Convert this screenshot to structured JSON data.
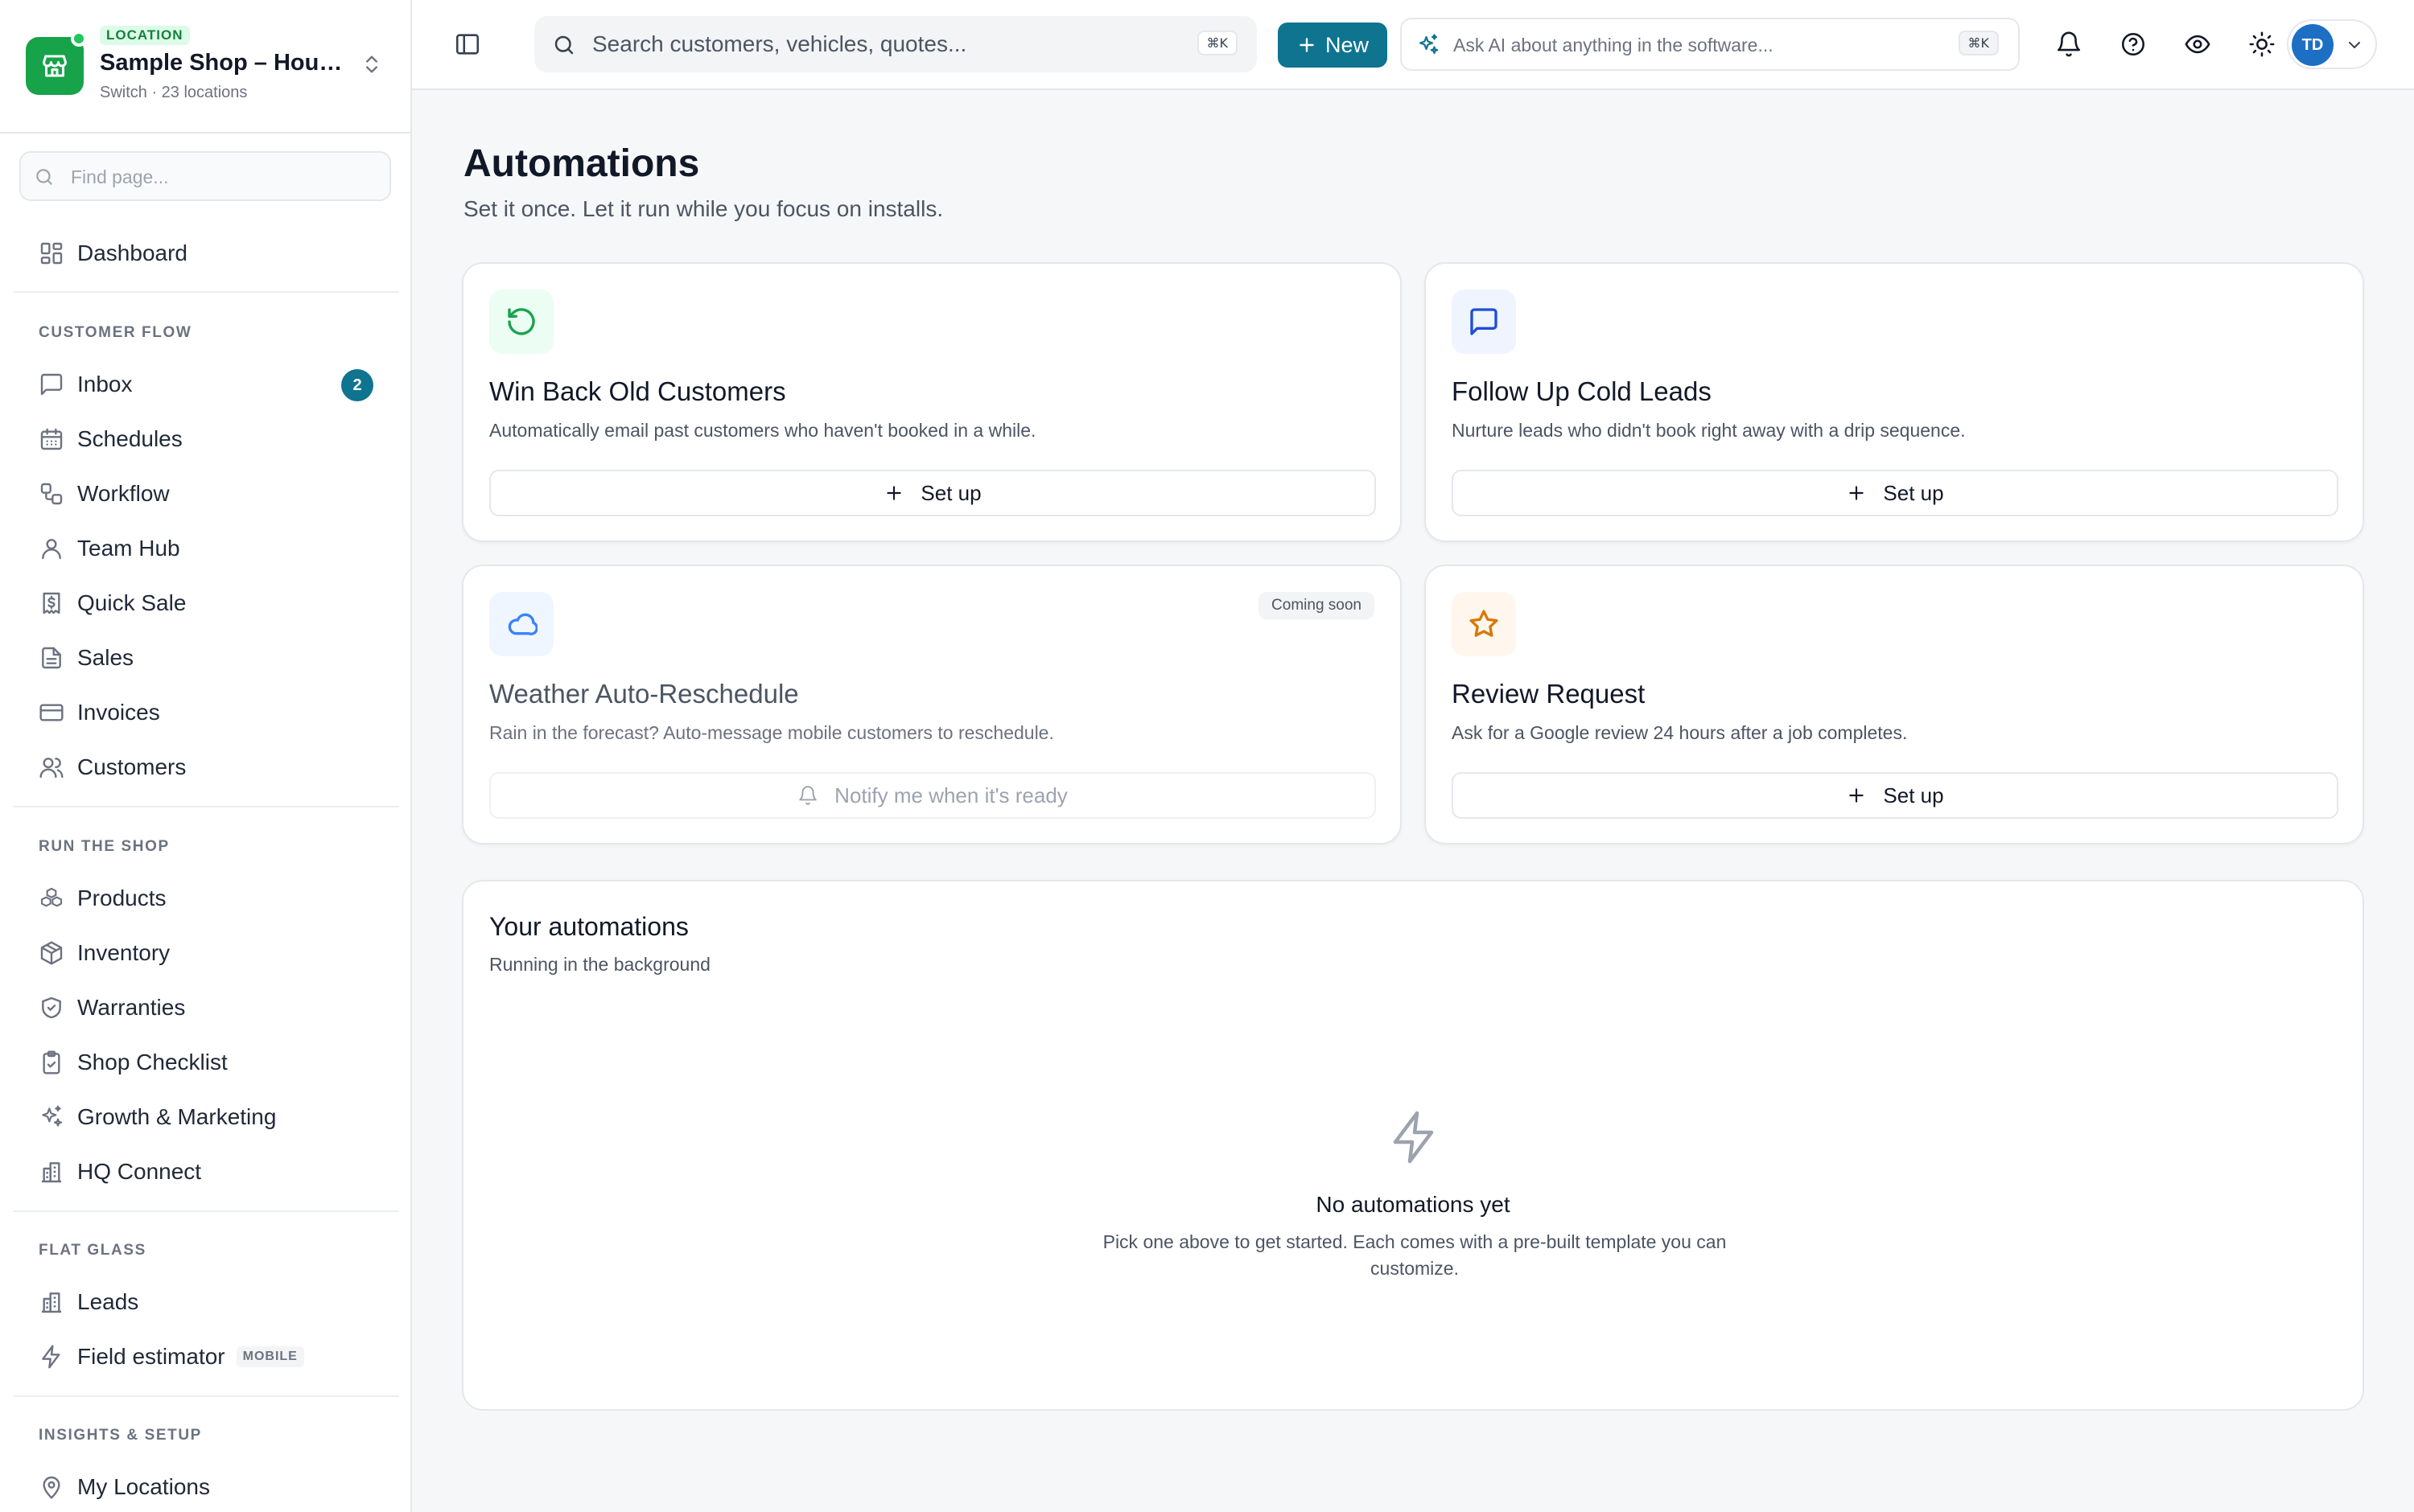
{
  "colors": {
    "accent": "#0e7490",
    "brand_green": "#16a34a",
    "win_back_icon": "#16a34a",
    "follow_up_icon": "#1d4ed8",
    "weather_icon": "#3b82f6",
    "review_icon": "#d97706"
  },
  "location": {
    "label": "LOCATION",
    "name": "Sample Shop – Houst...",
    "sub": "Switch · 23 locations",
    "icon": "store-icon"
  },
  "find": {
    "placeholder": "Find page..."
  },
  "nav": {
    "dashboard": {
      "label": "Dashboard",
      "icon": "dashboard-icon"
    },
    "sections": [
      {
        "title": "CUSTOMER FLOW",
        "items": [
          {
            "label": "Inbox",
            "badge": "2",
            "icon": "inbox-icon"
          },
          {
            "label": "Schedules",
            "icon": "calendar-icon"
          },
          {
            "label": "Workflow",
            "icon": "workflow-icon"
          },
          {
            "label": "Team Hub",
            "icon": "user-icon"
          },
          {
            "label": "Quick Sale",
            "icon": "receipt-dollar-icon"
          },
          {
            "label": "Sales",
            "icon": "document-icon"
          },
          {
            "label": "Invoices",
            "icon": "credit-card-icon"
          },
          {
            "label": "Customers",
            "icon": "users-icon"
          }
        ]
      },
      {
        "title": "RUN THE SHOP",
        "items": [
          {
            "label": "Products",
            "icon": "boxes-icon"
          },
          {
            "label": "Inventory",
            "icon": "package-icon"
          },
          {
            "label": "Warranties",
            "icon": "shield-check-icon"
          },
          {
            "label": "Shop Checklist",
            "icon": "clipboard-check-icon"
          },
          {
            "label": "Growth & Marketing",
            "icon": "sparkles-icon"
          },
          {
            "label": "HQ Connect",
            "icon": "building-icon"
          }
        ]
      },
      {
        "title": "FLAT GLASS",
        "items": [
          {
            "label": "Leads",
            "icon": "building-icon"
          },
          {
            "label": "Field estimator",
            "tag": "MOBILE",
            "icon": "zap-icon"
          }
        ]
      },
      {
        "title": "INSIGHTS & SETUP",
        "items": [
          {
            "label": "My Locations",
            "icon": "map-pin-icon"
          }
        ]
      }
    ]
  },
  "topbar": {
    "search_placeholder": "Search customers, vehicles, quotes...",
    "search_kbd": "⌘K",
    "new_label": "New",
    "ai_placeholder": "Ask AI about anything in the software...",
    "ai_kbd": "⌘K",
    "avatar_initials": "TD"
  },
  "page": {
    "title": "Automations",
    "subtitle": "Set it once. Let it run while you focus on installs."
  },
  "cards": [
    {
      "title": "Win Back Old Customers",
      "desc": "Automatically email past customers who haven't booked in a while.",
      "button": "Set up",
      "icon": "rotate-ccw-icon"
    },
    {
      "title": "Follow Up Cold Leads",
      "desc": "Nurture leads who didn't book right away with a drip sequence.",
      "button": "Set up",
      "icon": "message-square-icon"
    },
    {
      "title": "Weather Auto-Reschedule",
      "desc": "Rain in the forecast? Auto-message mobile customers to reschedule.",
      "button": "Notify me when it's ready",
      "badge": "Coming soon",
      "icon": "cloud-icon"
    },
    {
      "title": "Review Request",
      "desc": "Ask for a Google review 24 hours after a job completes.",
      "button": "Set up",
      "icon": "star-icon"
    }
  ],
  "automations": {
    "title": "Your automations",
    "subtitle": "Running in the background",
    "empty_title": "No automations yet",
    "empty_desc": "Pick one above to get started. Each comes with a pre-built template you can customize."
  }
}
